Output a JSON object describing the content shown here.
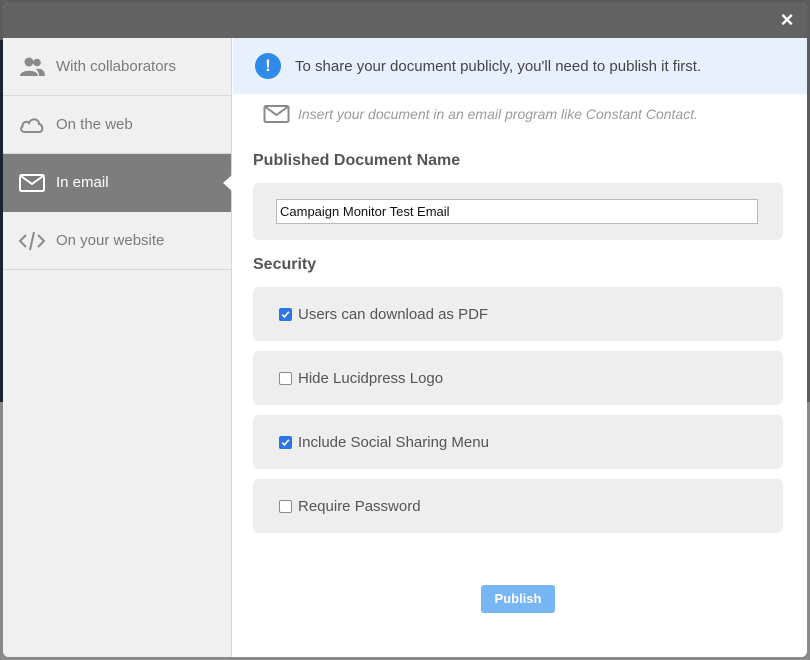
{
  "dialog": {
    "close_icon": "close-icon"
  },
  "sidebar": {
    "items": [
      {
        "label": "With collaborators",
        "icon": "people-icon",
        "active": false
      },
      {
        "label": "On the web",
        "icon": "cloud-icon",
        "active": false
      },
      {
        "label": "In email",
        "icon": "envelope-icon",
        "active": true
      },
      {
        "label": "On your website",
        "icon": "code-icon",
        "active": false
      }
    ]
  },
  "main": {
    "banner_text": "To share your document publicly, you'll need to publish it first.",
    "email_hint": "Insert your document in an email program like Constant Contact.",
    "published_name_title": "Published Document Name",
    "published_name_value": "Campaign Monitor Test Email",
    "security_title": "Security",
    "options": [
      {
        "label": "Users can download as PDF",
        "checked": true
      },
      {
        "label": "Hide Lucidpress Logo",
        "checked": false
      },
      {
        "label": "Include Social Sharing Menu",
        "checked": true
      },
      {
        "label": "Require Password",
        "checked": false
      }
    ],
    "publish_label": "Publish"
  },
  "colors": {
    "accent": "#2f8ae8",
    "checkbox_checked": "#2b76e6",
    "publish_button": "#77b6f5",
    "sidebar_active": "#7d7d7d"
  }
}
